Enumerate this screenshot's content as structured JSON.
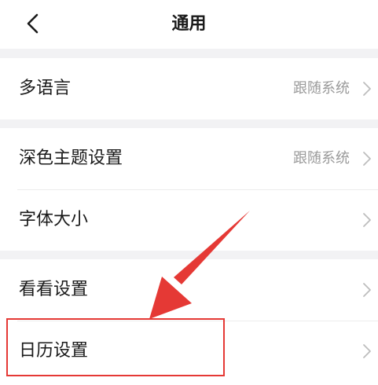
{
  "header": {
    "title": "通用",
    "back_icon": "chevron-left-icon"
  },
  "groups": [
    {
      "rows": [
        {
          "label": "多语言",
          "value": "跟随系统"
        }
      ]
    },
    {
      "rows": [
        {
          "label": "深色主题设置",
          "value": "跟随系统"
        },
        {
          "label": "字体大小",
          "value": ""
        }
      ]
    },
    {
      "rows": [
        {
          "label": "看看设置",
          "value": ""
        },
        {
          "label": "日历设置",
          "value": ""
        }
      ]
    }
  ],
  "colors": {
    "annotation": "#e53935",
    "background": "#f2f2f4"
  }
}
